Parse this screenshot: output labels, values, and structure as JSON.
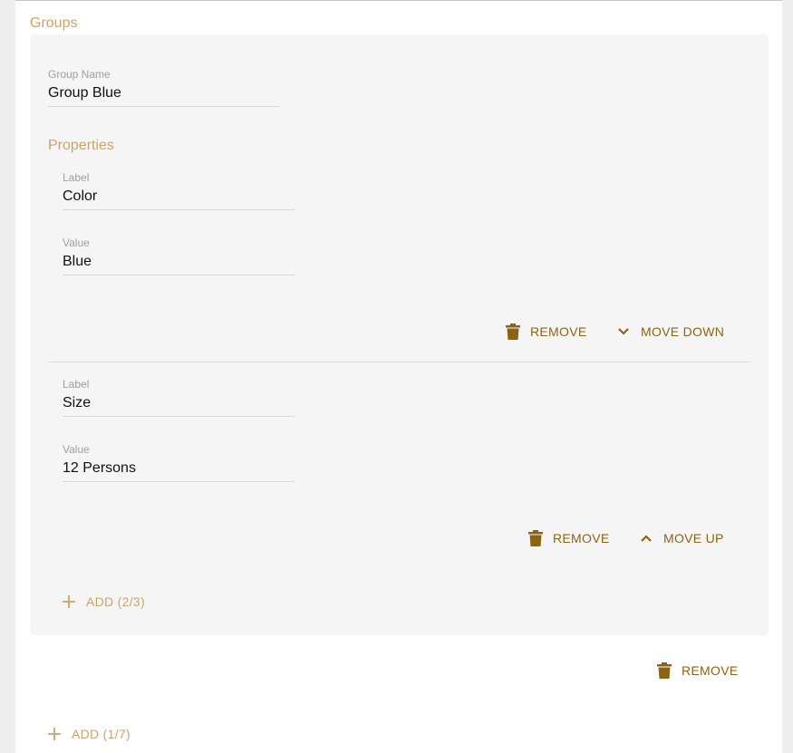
{
  "groups_title": "Groups",
  "group": {
    "name_label": "Group Name",
    "name_value": "Group Blue",
    "properties_title": "Properties",
    "properties": [
      {
        "label_caption": "Label",
        "label_value": "Color",
        "value_caption": "Value",
        "value_value": "Blue",
        "remove_label": "REMOVE",
        "move_label": "MOVE DOWN"
      },
      {
        "label_caption": "Label",
        "label_value": "Size",
        "value_caption": "Value",
        "value_value": "12 Persons",
        "remove_label": "REMOVE",
        "move_label": "MOVE UP"
      }
    ],
    "add_property_label": "ADD (2/3)",
    "remove_group_label": "REMOVE"
  },
  "add_group_label": "ADD (1/7)",
  "colors": {
    "accent": "#c8a46a",
    "button_dark": "#8a6414",
    "card_bg": "#f5f5f5"
  },
  "icons": {
    "remove": "trash-icon",
    "move_down": "chevron-down-icon",
    "move_up": "chevron-up-icon",
    "add": "plus-icon"
  }
}
